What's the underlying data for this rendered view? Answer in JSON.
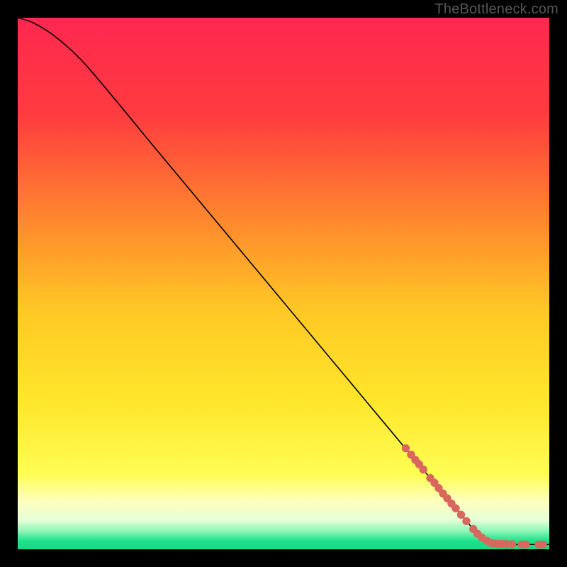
{
  "watermark": "TheBottleneck.com",
  "chart_data": {
    "type": "line",
    "title": "",
    "xlabel": "",
    "ylabel": "",
    "xlim": [
      0,
      100
    ],
    "ylim": [
      0,
      100
    ],
    "background_gradient": {
      "stops": [
        {
          "offset": 0.0,
          "color": "#ff2850"
        },
        {
          "offset": 0.18,
          "color": "#ff3b3f"
        },
        {
          "offset": 0.4,
          "color": "#ff8f2c"
        },
        {
          "offset": 0.55,
          "color": "#ffc825"
        },
        {
          "offset": 0.72,
          "color": "#ffe62a"
        },
        {
          "offset": 0.86,
          "color": "#fffd55"
        },
        {
          "offset": 0.91,
          "color": "#fdffbe"
        },
        {
          "offset": 0.945,
          "color": "#e7ffd8"
        },
        {
          "offset": 0.965,
          "color": "#90f7b8"
        },
        {
          "offset": 0.985,
          "color": "#1be08a"
        },
        {
          "offset": 1.0,
          "color": "#19d986"
        }
      ]
    },
    "series": [
      {
        "name": "curve",
        "color": "#000000",
        "width": 1.6,
        "points": [
          {
            "x": 0,
            "y": 100.0
          },
          {
            "x": 3,
            "y": 99.0
          },
          {
            "x": 7,
            "y": 96.5
          },
          {
            "x": 12,
            "y": 92.0
          },
          {
            "x": 18,
            "y": 85.0
          },
          {
            "x": 25,
            "y": 76.5
          },
          {
            "x": 35,
            "y": 64.5
          },
          {
            "x": 45,
            "y": 52.5
          },
          {
            "x": 55,
            "y": 40.5
          },
          {
            "x": 65,
            "y": 28.5
          },
          {
            "x": 75,
            "y": 16.5
          },
          {
            "x": 83,
            "y": 7.0
          },
          {
            "x": 86,
            "y": 3.5
          },
          {
            "x": 88,
            "y": 1.8
          },
          {
            "x": 90,
            "y": 1.0
          },
          {
            "x": 100,
            "y": 0.9
          }
        ]
      },
      {
        "name": "highlight-markers",
        "color": "#d8685e",
        "marker_radius": 5.7,
        "points": [
          {
            "x": 73.0,
            "y": 19.0
          },
          {
            "x": 74.0,
            "y": 17.8
          },
          {
            "x": 74.8,
            "y": 16.8
          },
          {
            "x": 75.5,
            "y": 16.0
          },
          {
            "x": 76.3,
            "y": 15.0
          },
          {
            "x": 77.6,
            "y": 13.4
          },
          {
            "x": 78.4,
            "y": 12.5
          },
          {
            "x": 79.2,
            "y": 11.5
          },
          {
            "x": 80.0,
            "y": 10.5
          },
          {
            "x": 80.8,
            "y": 9.6
          },
          {
            "x": 81.6,
            "y": 8.6
          },
          {
            "x": 82.4,
            "y": 7.7
          },
          {
            "x": 83.4,
            "y": 6.5
          },
          {
            "x": 84.4,
            "y": 5.3
          },
          {
            "x": 85.7,
            "y": 3.8
          },
          {
            "x": 86.5,
            "y": 2.9
          },
          {
            "x": 87.3,
            "y": 2.2
          },
          {
            "x": 88.2,
            "y": 1.6
          },
          {
            "x": 89.0,
            "y": 1.2
          },
          {
            "x": 89.8,
            "y": 1.05
          },
          {
            "x": 90.5,
            "y": 1.0
          },
          {
            "x": 91.3,
            "y": 1.0
          },
          {
            "x": 92.0,
            "y": 0.95
          },
          {
            "x": 93.0,
            "y": 0.95
          },
          {
            "x": 94.8,
            "y": 0.9
          },
          {
            "x": 95.6,
            "y": 0.9
          },
          {
            "x": 98.0,
            "y": 0.9
          },
          {
            "x": 98.8,
            "y": 0.9
          }
        ]
      }
    ]
  }
}
